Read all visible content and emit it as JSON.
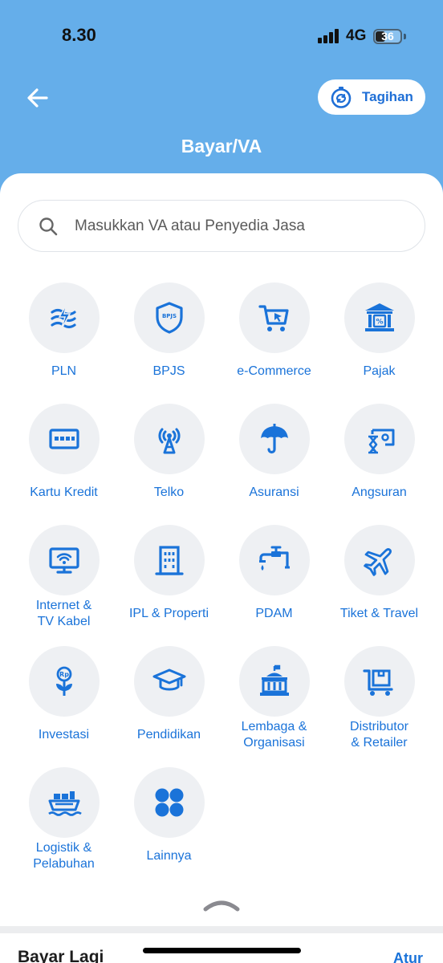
{
  "status_bar": {
    "time": "8.30",
    "network": "4G",
    "battery_percent": 36,
    "battery_label": "36"
  },
  "header": {
    "back_icon": "arrow-left-icon",
    "tagihan_label": "Tagihan",
    "tagihan_icon": "stopwatch-refresh-icon",
    "title": "Bayar/VA"
  },
  "search": {
    "placeholder": "Masukkan VA atau Penyedia Jasa",
    "value": "",
    "icon": "search-icon"
  },
  "categories": [
    {
      "label": "PLN",
      "icon": "electricity-icon"
    },
    {
      "label": "BPJS",
      "icon": "bpjs-shield-icon"
    },
    {
      "label": "e-Commerce",
      "icon": "shopping-cart-icon"
    },
    {
      "label": "Pajak",
      "icon": "tax-building-icon"
    },
    {
      "label": "Kartu Kredit",
      "icon": "credit-card-icon"
    },
    {
      "label": "Telko",
      "icon": "cell-tower-icon"
    },
    {
      "label": "Asuransi",
      "icon": "umbrella-icon"
    },
    {
      "label": "Angsuran",
      "icon": "installment-hourglass-icon"
    },
    {
      "label": "Internet &\nTV Kabel",
      "icon": "wifi-monitor-icon"
    },
    {
      "label": "IPL & Properti",
      "icon": "apartment-building-icon"
    },
    {
      "label": "PDAM",
      "icon": "water-tap-icon"
    },
    {
      "label": "Tiket & Travel",
      "icon": "airplane-icon"
    },
    {
      "label": "Investasi",
      "icon": "investment-plant-icon"
    },
    {
      "label": "Pendidikan",
      "icon": "graduation-cap-icon"
    },
    {
      "label": "Lembaga &\nOrganisasi",
      "icon": "institution-building-icon"
    },
    {
      "label": "Distributor\n& Retailer",
      "icon": "cart-box-icon"
    },
    {
      "label": "Logistik &\nPelabuhan",
      "icon": "cargo-ship-icon"
    },
    {
      "label": "Lainnya",
      "icon": "four-dots-icon"
    }
  ],
  "bottom": {
    "section_title": "Bayar Lagi",
    "action_label": "Atur"
  },
  "colors": {
    "header_bg": "#65aeea",
    "accent": "#1a73d9",
    "icon_circle": "#eef0f3"
  }
}
